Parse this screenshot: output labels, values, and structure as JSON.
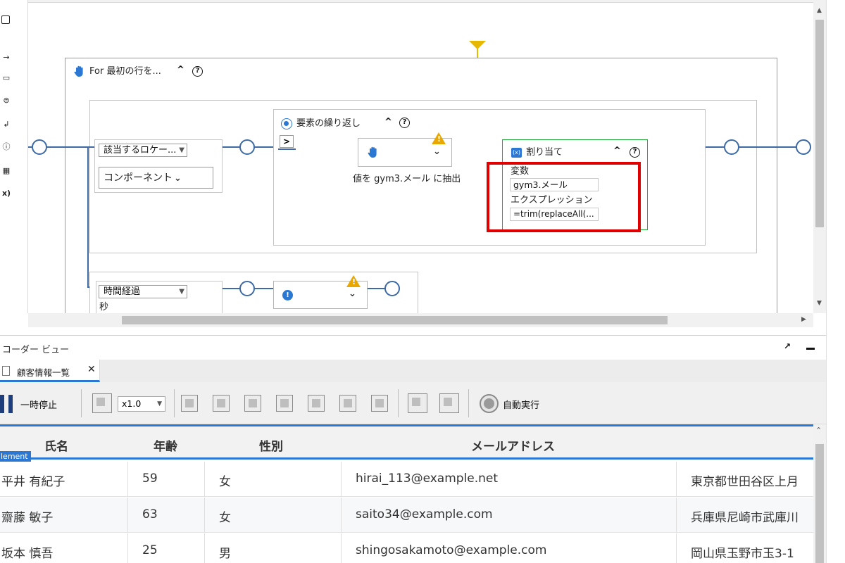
{
  "colors": {
    "wire": "#3d6aa5",
    "yellow_line": "#e6b800",
    "highlight_red": "#e00000",
    "assign_green": "#22aa3a",
    "accent_blue": "#2b78d4"
  },
  "canvas": {
    "for_block": {
      "title": "For 最初の行を...",
      "icon": "hand-icon"
    },
    "locator": {
      "dropdown": "該当するロケー...",
      "component": "コンポーネント"
    },
    "repeat_block": {
      "title": "要素の繰り返し",
      "expand_symbol": ">"
    },
    "extract_step": {
      "caption": "値を gym3.メール に抽出"
    },
    "assign_block": {
      "title": "割り当て",
      "variable_label": "変数",
      "variable_value": "gym3.メール",
      "expression_label": "エクスプレッション",
      "expression_value": "=trim(replaceAll(..."
    },
    "time_block": {
      "dropdown": "時間経過",
      "unit": "秒"
    }
  },
  "bottom_panel": {
    "title": "コーダー ビュー",
    "tab_label": "顧客情報一覧",
    "toolbar": {
      "pause_label": "一時停止",
      "speed": "x1.0",
      "auto_label": "自動実行"
    },
    "element_badge": "lement",
    "table": {
      "headers": [
        "氏名",
        "年齢",
        "性別",
        "メールアドレス"
      ],
      "rows": [
        [
          "平井 有紀子",
          "59",
          "女",
          "hirai_113@example.net",
          "東京都世田谷区上月"
        ],
        [
          "齋藤 敏子",
          "63",
          "女",
          "saito34@example.com",
          "兵庫県尼崎市武庫川"
        ],
        [
          "坂本 慎吾",
          "25",
          "男",
          "shingosakamoto@example.com",
          "岡山県玉野市玉3-1"
        ]
      ]
    }
  }
}
